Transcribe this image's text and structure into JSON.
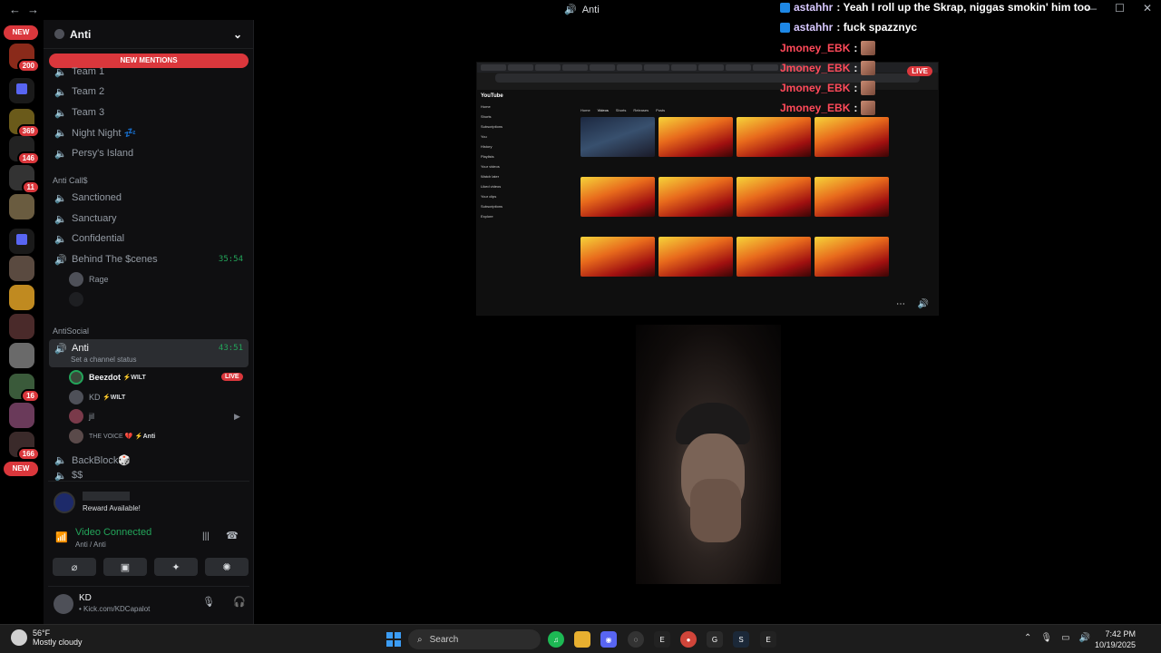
{
  "titlebar": {
    "title": "Anti"
  },
  "guilds": [
    {
      "badge": "NEW"
    },
    {
      "count": "200"
    },
    {
      "count": "369"
    },
    {
      "count": "146"
    },
    {
      "count": "11"
    },
    {
      "count": "16"
    },
    {
      "count": "166"
    },
    {
      "badge": "NEW"
    }
  ],
  "sidebar": {
    "server_name": "Anti",
    "new_mentions": "NEW MENTIONS",
    "channels_top": [
      {
        "name": "Team 1"
      },
      {
        "name": "Team 2"
      },
      {
        "name": "Team 3"
      },
      {
        "name": "Night Night 💤"
      },
      {
        "name": "Persy's Island"
      }
    ],
    "category_anti_calls": "Anti Call$",
    "channels_mid": [
      {
        "name": "Sanctioned"
      },
      {
        "name": "Sanctuary"
      },
      {
        "name": "Confidential"
      },
      {
        "name": "Behind The $cenes",
        "time": "35:54"
      }
    ],
    "rage_user": "Rage",
    "category_antisocial": "AntiSocial",
    "active_channel": {
      "name": "Anti",
      "time": "43:51",
      "status": "Set a channel status"
    },
    "users": [
      {
        "name": "Beezdot",
        "tag": "⚡WILT",
        "live": "LIVE"
      },
      {
        "name": "KD",
        "tag": "⚡WILT"
      },
      {
        "name": "jil"
      },
      {
        "name": "THE VOICE 💔",
        "tag": "⚡Anti"
      }
    ],
    "channels_bottom": [
      {
        "name": "BackBlock🎲"
      },
      {
        "name": "$$"
      }
    ]
  },
  "reward": {
    "text": "Reward Available!"
  },
  "voice": {
    "status": "Video Connected",
    "location": "Anti / Anti"
  },
  "user_panel": {
    "name": "KD",
    "status": "• Kick.com/KDCapalot"
  },
  "stream": {
    "live": "LIVE",
    "youtube": "YouTube",
    "sidebar": [
      "Home",
      "Shorts",
      "Subscriptions",
      "You",
      "History",
      "Playlists",
      "Your videos",
      "Watch later",
      "Liked videos",
      "Your clips",
      "Subscriptions",
      "Explore"
    ],
    "tabs": [
      "Home",
      "Videos",
      "Shorts",
      "Releases",
      "Posts"
    ]
  },
  "chat": [
    {
      "user": "astahhr",
      "text": ": Yeah I roll up the Skrap, niggas smokin' him too",
      "color": "#d8c8ff"
    },
    {
      "user": "astahhr",
      "text": ": fuck spazznyc",
      "color": "#d8c8ff"
    },
    {
      "user": "Jmoney_EBK",
      "text": ":",
      "color": "#ff4a5a"
    },
    {
      "user": "Jmoney_EBK",
      "text": ":",
      "color": "#ff4a5a"
    },
    {
      "user": "Jmoney_EBK",
      "text": ":",
      "color": "#ff4a5a"
    },
    {
      "user": "Jmoney_EBK",
      "text": ":",
      "color": "#ff4a5a"
    }
  ],
  "taskbar": {
    "temp": "56°F",
    "weather": "Mostly cloudy",
    "search": "Search",
    "time": "7:42 PM",
    "date": "10/19/2025"
  }
}
